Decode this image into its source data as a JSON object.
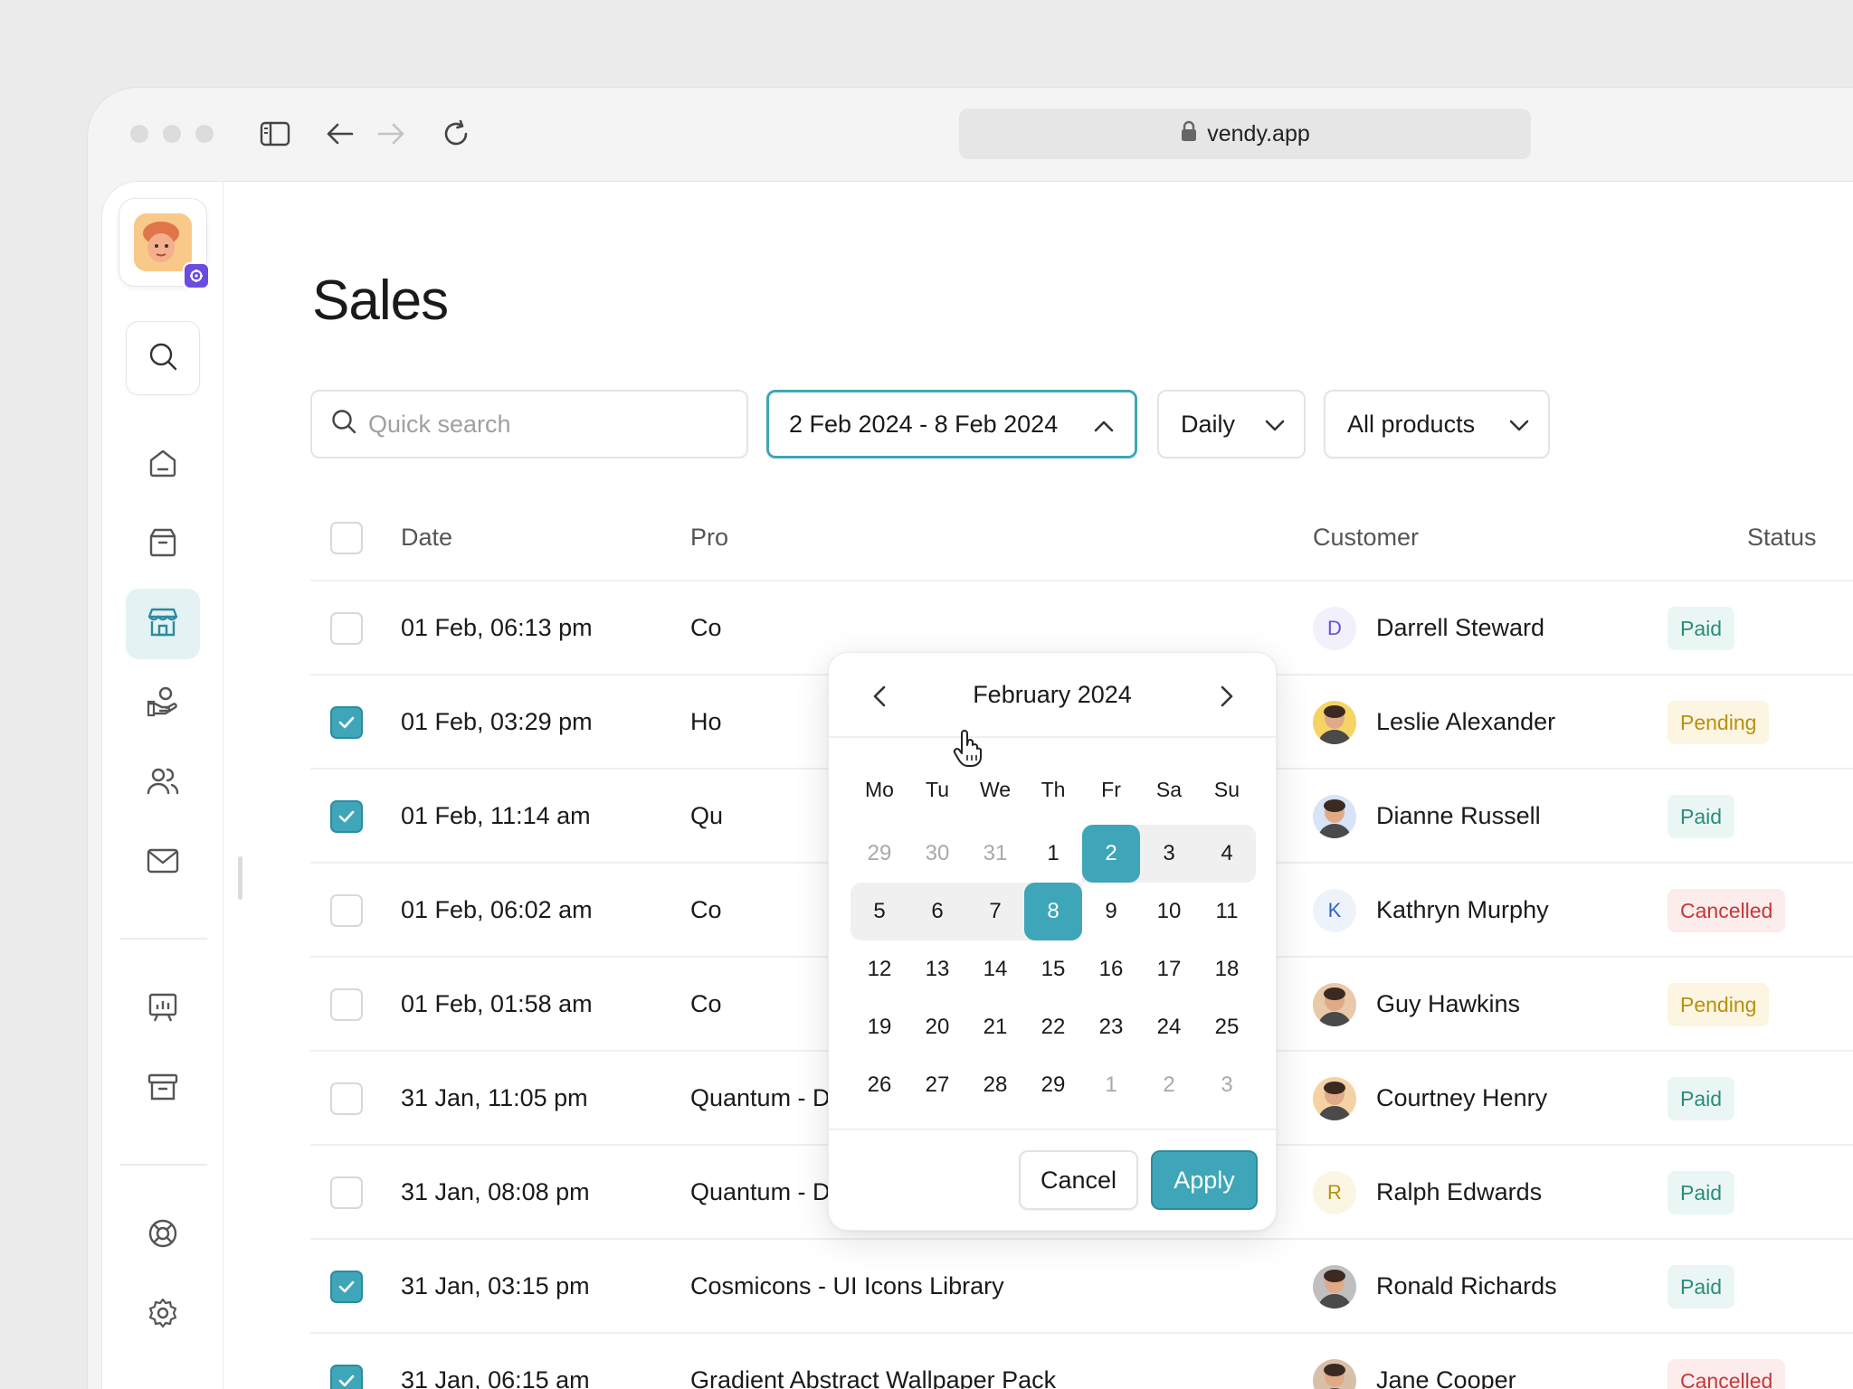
{
  "browser": {
    "url": "vendy.app"
  },
  "page": {
    "title": "Sales"
  },
  "filters": {
    "search_placeholder": "Quick search",
    "date_range": "2 Feb 2024 - 8 Feb 2024",
    "interval": "Daily",
    "products": "All products"
  },
  "table": {
    "headers": {
      "date": "Date",
      "product": "Pro",
      "customer": "Customer",
      "status": "Status"
    },
    "rows": [
      {
        "date": "01 Feb, 06:13 pm",
        "product": "Co",
        "customer": "Darrell Steward",
        "initial": "D",
        "status": "Paid",
        "checked": false
      },
      {
        "date": "01 Feb, 03:29 pm",
        "product": "Ho",
        "customer": "Leslie Alexander",
        "initial": "",
        "status": "Pending",
        "checked": true
      },
      {
        "date": "01 Feb, 11:14 am",
        "product": "Qu",
        "customer": "Dianne Russell",
        "initial": "",
        "status": "Paid",
        "checked": true
      },
      {
        "date": "01 Feb, 06:02 am",
        "product": "Co",
        "customer": "Kathryn Murphy",
        "initial": "K",
        "status": "Cancelled",
        "checked": false
      },
      {
        "date": "01 Feb, 01:58 am",
        "product": "Co",
        "customer": "Guy Hawkins",
        "initial": "",
        "status": "Pending",
        "checked": false
      },
      {
        "date": "31 Jan, 11:05 pm",
        "product": "Quantum - Design System for Figma",
        "customer": "Courtney Henry",
        "initial": "",
        "status": "Paid",
        "checked": false
      },
      {
        "date": "31 Jan, 08:08 pm",
        "product": "Quantum - Design System for Figma",
        "customer": "Ralph Edwards",
        "initial": "R",
        "status": "Paid",
        "checked": false
      },
      {
        "date": "31 Jan, 03:15 pm",
        "product": "Cosmicons - UI Icons Library",
        "customer": "Ronald Richards",
        "initial": "",
        "status": "Paid",
        "checked": true
      },
      {
        "date": "31 Jan, 06:15 am",
        "product": "Gradient Abstract Wallpaper Pack",
        "customer": "Jane Cooper",
        "initial": "",
        "status": "Cancelled",
        "checked": true
      }
    ]
  },
  "calendar": {
    "month_label": "February 2024",
    "weekdays": [
      "Mo",
      "Tu",
      "We",
      "Th",
      "Fr",
      "Sa",
      "Su"
    ],
    "weeks": [
      [
        "29",
        "30",
        "31",
        "1",
        "2",
        "3",
        "4"
      ],
      [
        "5",
        "6",
        "7",
        "8",
        "9",
        "10",
        "11"
      ],
      [
        "12",
        "13",
        "14",
        "15",
        "16",
        "17",
        "18"
      ],
      [
        "19",
        "20",
        "21",
        "22",
        "23",
        "24",
        "25"
      ],
      [
        "26",
        "27",
        "28",
        "29",
        "1",
        "2",
        "3"
      ]
    ],
    "cancel_label": "Cancel",
    "apply_label": "Apply"
  },
  "colors": {
    "accent": "#3ea6b8",
    "paid": "#2b8c7a",
    "pending": "#b8900f",
    "cancelled": "#c63838"
  }
}
